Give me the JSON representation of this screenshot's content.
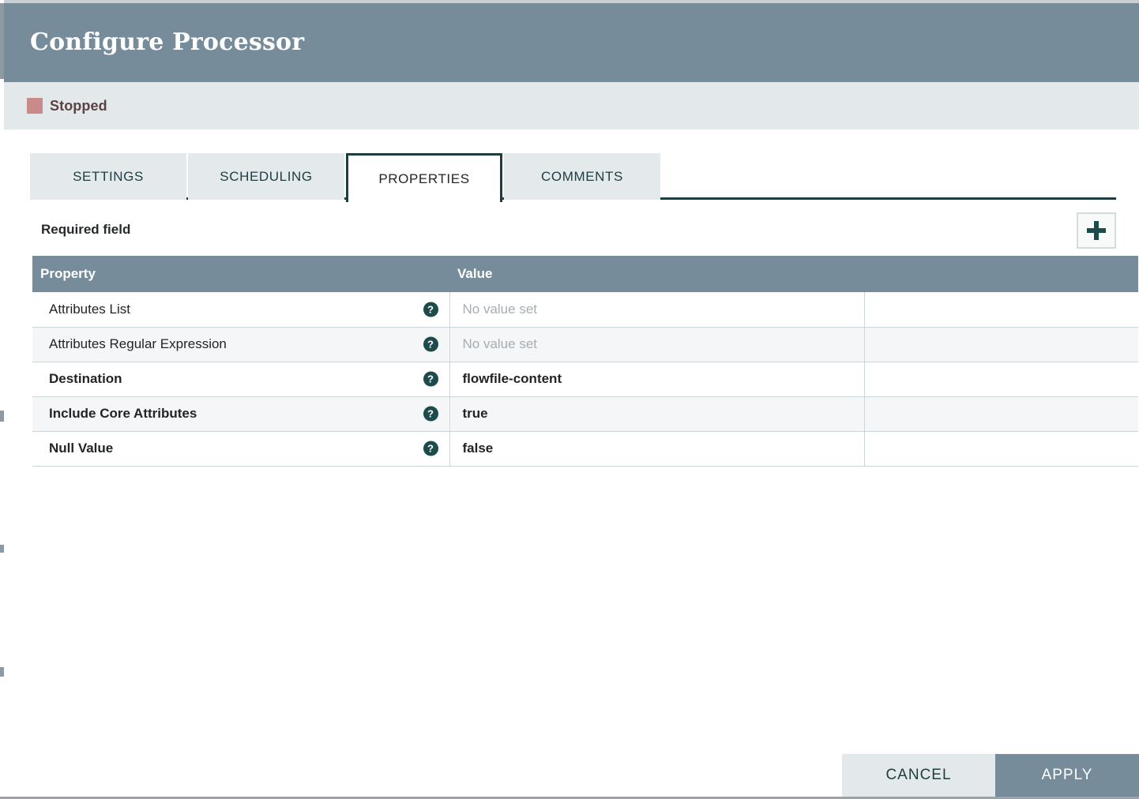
{
  "dialog": {
    "title": "Configure Processor",
    "status": {
      "label": "Stopped",
      "color": "#c98a8a"
    }
  },
  "tabs": [
    {
      "label": "SETTINGS",
      "active": false
    },
    {
      "label": "SCHEDULING",
      "active": false
    },
    {
      "label": "PROPERTIES",
      "active": true
    },
    {
      "label": "COMMENTS",
      "active": false
    }
  ],
  "properties_panel": {
    "required_field_label": "Required field",
    "add_button_label": "+",
    "columns": {
      "property": "Property",
      "value": "Value",
      "actions": ""
    },
    "rows": [
      {
        "name": "Attributes List",
        "required": false,
        "value": "No value set",
        "value_is_placeholder": true,
        "help_glyph": "?"
      },
      {
        "name": "Attributes Regular Expression",
        "required": false,
        "value": "No value set",
        "value_is_placeholder": true,
        "help_glyph": "?"
      },
      {
        "name": "Destination",
        "required": true,
        "value": "flowfile-content",
        "value_is_placeholder": false,
        "help_glyph": "?"
      },
      {
        "name": "Include Core Attributes",
        "required": true,
        "value": "true",
        "value_is_placeholder": false,
        "help_glyph": "?"
      },
      {
        "name": "Null Value",
        "required": true,
        "value": "false",
        "value_is_placeholder": false,
        "help_glyph": "?"
      }
    ]
  },
  "footer": {
    "cancel_label": "CANCEL",
    "apply_label": "APPLY"
  },
  "theme": {
    "header_bg": "#768c9a",
    "accent_dark": "#1d3d40",
    "status_bar_bg": "#e3e8ea",
    "row_alt_bg": "#f4f6f7",
    "help_icon_bg": "#1d4a4a"
  }
}
